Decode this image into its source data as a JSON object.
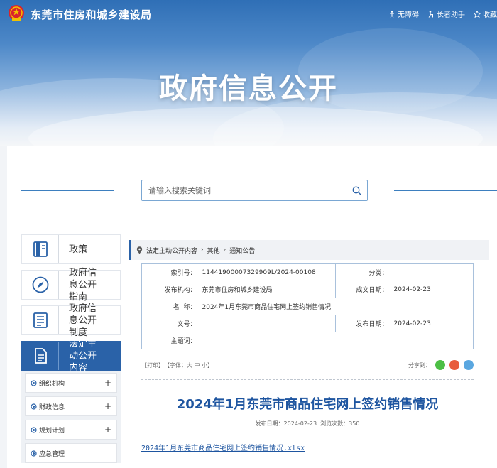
{
  "site": {
    "name": "东莞市住房和城乡建设局",
    "tools": [
      "无障碍",
      "长者助手",
      "收藏"
    ]
  },
  "hero": {
    "title": "政府信息公开"
  },
  "search": {
    "placeholder": "请输入搜索关键词"
  },
  "sidebar": {
    "items": [
      {
        "label": "政策",
        "icon": "book-icon"
      },
      {
        "label": "政府信息公开指南",
        "icon": "compass-icon"
      },
      {
        "label": "政府信息公开制度",
        "icon": "list-doc-icon"
      },
      {
        "label": "法定主动公开内容",
        "icon": "document-icon",
        "active": true
      }
    ],
    "subitems": [
      {
        "label": "组织机构",
        "expand": "+"
      },
      {
        "label": "财政信息",
        "expand": "+"
      },
      {
        "label": "规划计划",
        "expand": "+"
      },
      {
        "label": "应急管理",
        "expand": ""
      }
    ]
  },
  "breadcrumb": {
    "items": [
      "法定主动公开内容",
      "其他",
      "通知公告"
    ]
  },
  "meta": {
    "index_label": "索引号：",
    "index_value": "11441900007329909L/2024-00108",
    "category_label": "分类：",
    "category_value": "",
    "publisher_label": "发布机构：",
    "publisher_value": "东莞市住房和城乡建设局",
    "doc_date_label": "成文日期：",
    "doc_date_value": "2024-02-23",
    "name_label": "名  称：",
    "name_value": "2024年1月东莞市商品住宅网上签约销售情况",
    "docno_label": "文号：",
    "docno_value": "",
    "pub_date_label": "发布日期：",
    "pub_date_value": "2024-02-23",
    "subject_label": "主题词：",
    "subject_value": ""
  },
  "article_tools": {
    "print": "【打印】",
    "font": "【字体：大 中 小】",
    "share": "分享到："
  },
  "article": {
    "title": "2024年1月东莞市商品住宅网上签约销售情况",
    "meta": "发布日期：2024-02-23  浏览次数：350",
    "attachment": "2024年1月东莞市商品住宅网上签约销售情况.xlsx"
  },
  "colors": {
    "brand": "#2a62a8",
    "title": "#1e55a0",
    "wechat": "#4cbf45",
    "weibo": "#e85c3c",
    "qq": "#5aa7e0"
  }
}
